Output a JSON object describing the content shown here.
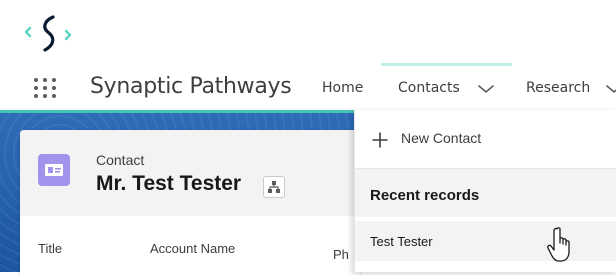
{
  "app": {
    "name": "Synaptic Pathways"
  },
  "nav": {
    "items": [
      {
        "label": "Home"
      },
      {
        "label": "Contacts"
      },
      {
        "label": "Research"
      }
    ]
  },
  "record": {
    "object_label": "Contact",
    "title": "Mr. Test Tester",
    "fields": [
      {
        "label": "Title"
      },
      {
        "label": "Account Name"
      },
      {
        "label": "Ph"
      }
    ]
  },
  "menu": {
    "new_label": "New Contact",
    "recent_header": "Recent records",
    "recent_items": [
      {
        "label": "Test Tester"
      }
    ]
  },
  "colors": {
    "accent_teal": "#43c6b6",
    "contact_icon": "#a094ed",
    "logo_left": "#5ed6c4",
    "logo_main": "#0b1a33"
  },
  "icons": {
    "logo": "synaptic-logo",
    "app_launcher": "waffle-icon",
    "nav_chevron": "chevron-down-icon",
    "add": "plus-icon",
    "contact": "contact-card-icon",
    "hierarchy": "hierarchy-icon",
    "pointer": "hand-pointer-icon"
  }
}
